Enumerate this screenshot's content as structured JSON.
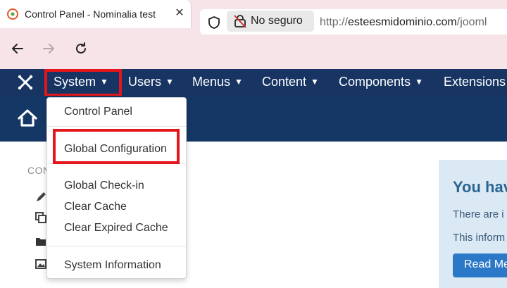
{
  "browser": {
    "tab_title": "Control Panel - Nominalia test",
    "tab_close": "✕",
    "new_tab": "+",
    "security_label": "No seguro",
    "url_prefix": "http://",
    "url_host": "esteesmidominio.com",
    "url_rest": "/jooml"
  },
  "topnav": {
    "items": [
      {
        "label": "System"
      },
      {
        "label": "Users"
      },
      {
        "label": "Menus"
      },
      {
        "label": "Content"
      },
      {
        "label": "Components"
      },
      {
        "label": "Extensions"
      }
    ],
    "caret": "▼"
  },
  "system_menu": {
    "items": [
      {
        "label": "Control Panel"
      },
      {
        "label": "Global Configuration"
      },
      {
        "label": "Global Check-in"
      },
      {
        "label": "Clear Cache"
      },
      {
        "label": "Clear Expired Cache"
      },
      {
        "label": "System Information"
      }
    ]
  },
  "content": {
    "section_label": "CON"
  },
  "notice": {
    "title": "You hav",
    "line1": "There are i",
    "line2": "This inform",
    "button": "Read Me"
  },
  "colors": {
    "nav_bg": "#173463",
    "header_bg": "#153766",
    "highlight": "#e2161b",
    "notice_bg": "#dbe9f5",
    "button": "#2a78c7"
  }
}
